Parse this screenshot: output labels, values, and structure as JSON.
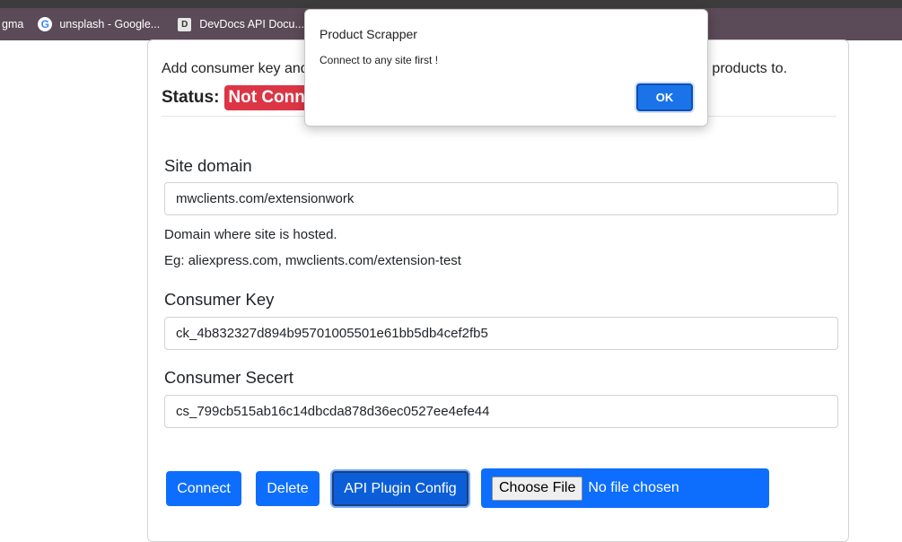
{
  "browser": {
    "bookmarks": [
      {
        "label": "gma"
      },
      {
        "label": "unsplash - Google..."
      },
      {
        "label": "DevDocs API Docu..."
      }
    ]
  },
  "card": {
    "intro_left": "Add consumer key and",
    "intro_right": "r products to.",
    "status_label": "Status:",
    "status_value": "Not Conne",
    "fields": {
      "domain": {
        "label": "Site domain",
        "value": "mwclients.com/extensionwork",
        "help1": "Domain where site is hosted.",
        "help2": "Eg: aliexpress.com, mwclients.com/extension-test"
      },
      "key": {
        "label": "Consumer Key",
        "value": "ck_4b832327d894b95701005501e61bb5db4cef2fb5"
      },
      "secret": {
        "label": "Consumer Secert",
        "value": "cs_799cb515ab16c14dbcda878d36ec0527ee4efe44"
      }
    },
    "buttons": {
      "connect": "Connect",
      "delete": "Delete",
      "api_config": "API Plugin Config",
      "choose_file": "Choose File",
      "no_file": "No file chosen"
    }
  },
  "dialog": {
    "title": "Product Scrapper",
    "message": "Connect to any site first !",
    "ok": "OK"
  },
  "colors": {
    "primary": "#0d6efd",
    "danger": "#dc3545",
    "bookmark_bar": "#5b4a57"
  }
}
